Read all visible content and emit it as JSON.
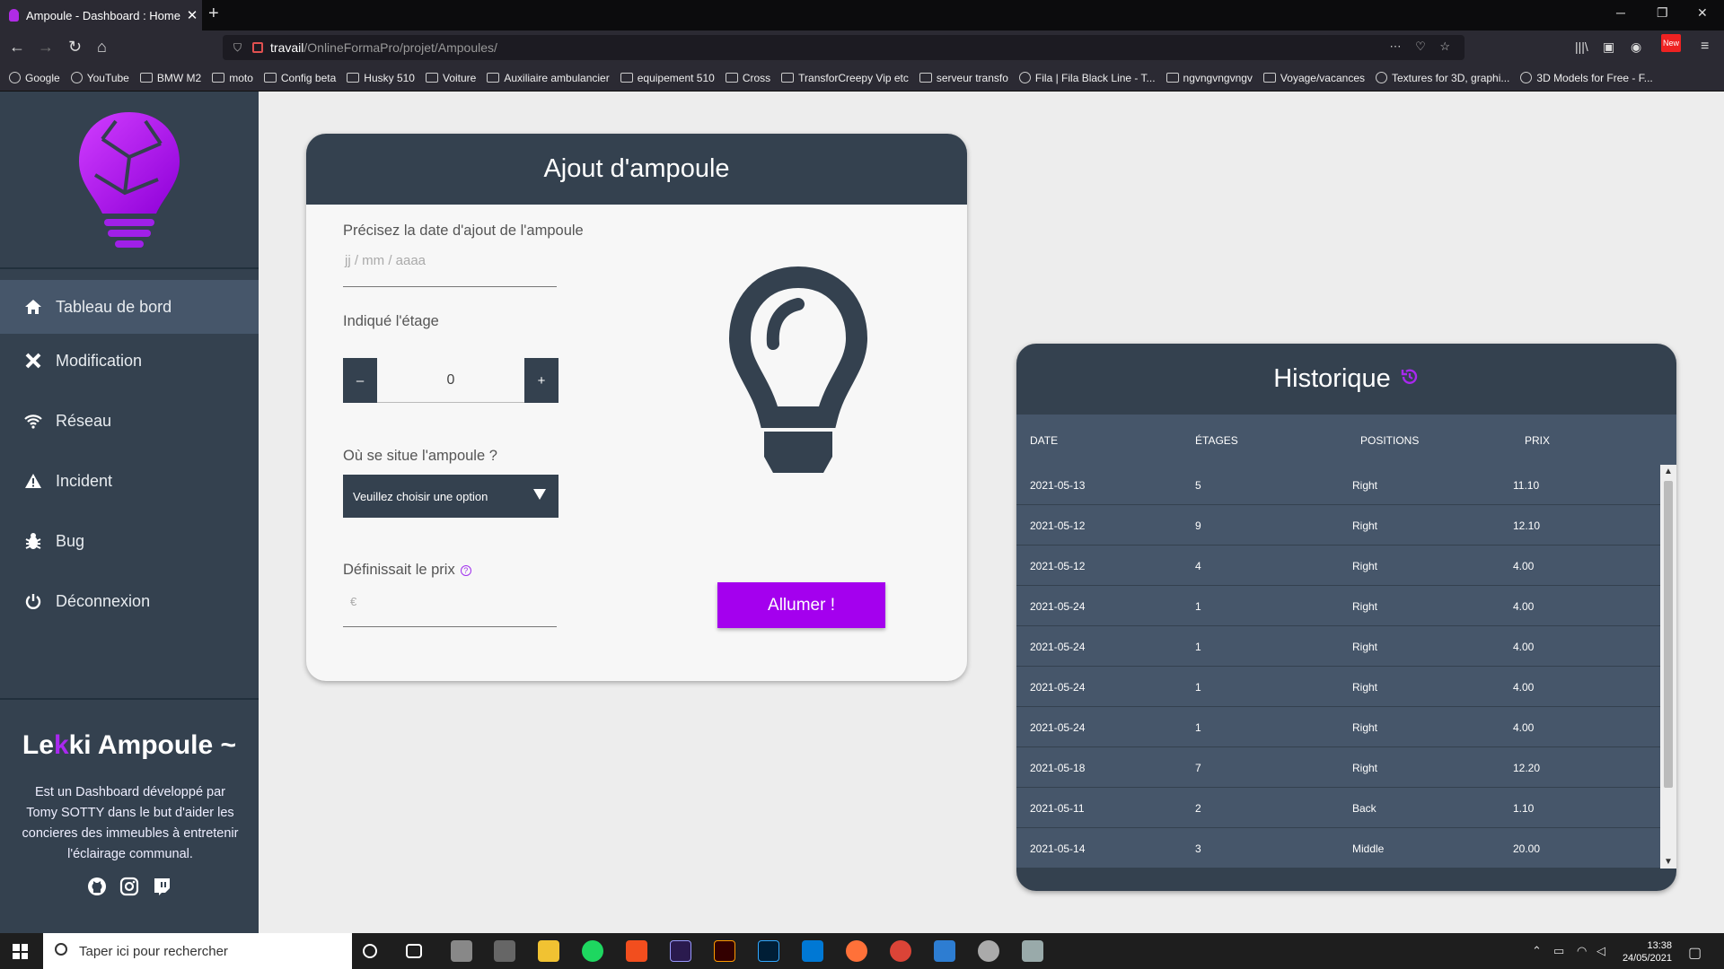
{
  "browser": {
    "tab_title": "Ampoule - Dashboard : Home",
    "url_host": "travail",
    "url_path": "/OnlineFormaPro/projet/Ampoules/",
    "new_badge": "New"
  },
  "bookmarks": [
    {
      "label": "Google",
      "icon": "globe-icon"
    },
    {
      "label": "YouTube",
      "icon": "globe-icon"
    },
    {
      "label": "BMW M2",
      "icon": "folder-icon"
    },
    {
      "label": "moto",
      "icon": "folder-icon"
    },
    {
      "label": "Config beta",
      "icon": "folder-icon"
    },
    {
      "label": "Husky 510",
      "icon": "folder-icon"
    },
    {
      "label": "Voiture",
      "icon": "folder-icon"
    },
    {
      "label": "Auxiliaire ambulancier",
      "icon": "folder-icon"
    },
    {
      "label": "equipement 510",
      "icon": "folder-icon"
    },
    {
      "label": "Cross",
      "icon": "folder-icon"
    },
    {
      "label": "TransforCreepy Vip etc",
      "icon": "folder-icon"
    },
    {
      "label": "serveur transfo",
      "icon": "folder-icon"
    },
    {
      "label": "Fila | Fila Black Line - T...",
      "icon": "globe-icon"
    },
    {
      "label": "ngvngvngvngv",
      "icon": "folder-icon"
    },
    {
      "label": "Voyage/vacances",
      "icon": "folder-icon"
    },
    {
      "label": "Textures for 3D, graphi...",
      "icon": "globe-icon"
    },
    {
      "label": "3D Models for Free - F...",
      "icon": "globe-icon"
    }
  ],
  "sidebar": {
    "items": [
      {
        "label": "Tableau de bord",
        "icon": "home-icon",
        "active": true
      },
      {
        "label": "Modification",
        "icon": "tools-icon"
      },
      {
        "label": "Réseau",
        "icon": "wifi-icon"
      },
      {
        "label": "Incident",
        "icon": "warning-icon"
      },
      {
        "label": "Bug",
        "icon": "bug-icon"
      },
      {
        "label": "Déconnexion",
        "icon": "power-icon"
      }
    ],
    "brand_pre": "Le",
    "brand_k": "k",
    "brand_post": "ki Ampoule ~",
    "description": "Est un Dashboard développé par Tomy SOTTY dans le but d'aider les concieres des immeubles à entretenir l'éclairage communal.",
    "social": [
      "github-icon",
      "instagram-icon",
      "twitch-icon"
    ]
  },
  "form": {
    "title": "Ajout d'ampoule",
    "date_label": "Précisez la date d'ajout de l'ampoule",
    "date_placeholder": "jj / mm / aaaa",
    "floor_label": "Indiqué l'étage",
    "floor_minus": "–",
    "floor_value": "0",
    "floor_plus": "+",
    "position_label": "Où se situe l'ampoule ?",
    "position_select": "Veuillez choisir une option",
    "price_label": "Définissait le prix",
    "price_help": "?",
    "price_placeholder": "€",
    "submit": "Allumer !"
  },
  "history": {
    "title": "Historique",
    "columns": [
      "DATE",
      "ÉTAGES",
      "POSITIONS",
      "PRIX"
    ],
    "rows": [
      [
        "2021-05-13",
        "5",
        "Right",
        "11.10"
      ],
      [
        "2021-05-12",
        "9",
        "Right",
        "12.10"
      ],
      [
        "2021-05-12",
        "4",
        "Right",
        "4.00"
      ],
      [
        "2021-05-24",
        "1",
        "Right",
        "4.00"
      ],
      [
        "2021-05-24",
        "1",
        "Right",
        "4.00"
      ],
      [
        "2021-05-24",
        "1",
        "Right",
        "4.00"
      ],
      [
        "2021-05-24",
        "1",
        "Right",
        "4.00"
      ],
      [
        "2021-05-18",
        "7",
        "Right",
        "12.20"
      ],
      [
        "2021-05-11",
        "2",
        "Back",
        "1.10"
      ],
      [
        "2021-05-14",
        "3",
        "Middle",
        "20.00"
      ]
    ]
  },
  "taskbar": {
    "search_placeholder": "Taper ici pour rechercher",
    "time": "13:38",
    "date": "24/05/2021"
  },
  "colors": {
    "accent": "#a400ee",
    "sidebar": "#34414f",
    "table_row": "#46566a"
  }
}
